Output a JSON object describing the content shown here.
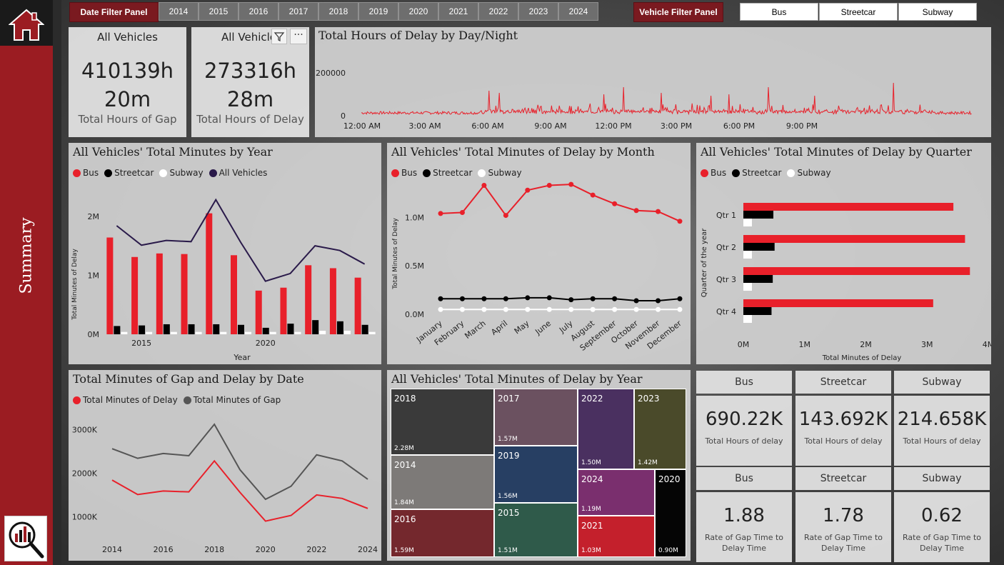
{
  "sidebar": {
    "label": "Summary"
  },
  "filters": {
    "date_panel_label": "Date Filter Panel",
    "years": [
      "2014",
      "2015",
      "2016",
      "2017",
      "2018",
      "2019",
      "2020",
      "2021",
      "2022",
      "2023",
      "2024"
    ],
    "vehicle_panel_label": "Vehicle Filter Panel",
    "vehicles": [
      "Bus",
      "Streetcar",
      "Subway"
    ]
  },
  "kpis": [
    {
      "title": "All Vehicles",
      "value_line1": "410139h",
      "value_line2": "20m",
      "subtitle": "Total Hours of Gap"
    },
    {
      "title": "All Vehicles",
      "value_line1": "273316h",
      "value_line2": "28m",
      "subtitle": "Total Hours of Delay"
    }
  ],
  "daynight": {
    "title": "Total Hours of Delay by Day/Night",
    "y_ticks": [
      "200000",
      "0"
    ],
    "x_ticks": [
      "12:00 AM",
      "3:00 AM",
      "6:00 AM",
      "9:00 AM",
      "12:00 PM",
      "3:00 PM",
      "6:00 PM",
      "9:00 PM"
    ]
  },
  "by_year": {
    "title": "All Vehicles' Total Minutes by Year",
    "legend": [
      "Bus",
      "Streetcar",
      "Subway",
      "All Vehicles"
    ],
    "y_ticks": [
      "2M",
      "1M",
      "0M"
    ],
    "y_label": "Total Minutes of Delay",
    "x_ticks": [
      "2015",
      "2020"
    ],
    "x_label": "Year"
  },
  "by_month": {
    "title": "All Vehicles' Total Minutes of Delay by Month",
    "legend": [
      "Bus",
      "Streetcar",
      "Subway"
    ],
    "y_ticks": [
      "1.0M",
      "0.5M",
      "0.0M"
    ],
    "y_label": "Total Minutes of Delay",
    "x_ticks": [
      "January",
      "February",
      "March",
      "April",
      "May",
      "June",
      "July",
      "August",
      "September",
      "October",
      "November",
      "December"
    ]
  },
  "by_quarter": {
    "title": "All Vehicles' Total Minutes of Delay by Quarter",
    "legend": [
      "Bus",
      "Streetcar",
      "Subway"
    ],
    "y_ticks": [
      "Qtr 1",
      "Qtr 2",
      "Qtr 3",
      "Qtr 4"
    ],
    "y_label": "Quarter of the year",
    "x_ticks": [
      "0M",
      "1M",
      "2M",
      "3M",
      "4M"
    ],
    "x_label": "Total Minutes of Delay"
  },
  "gap_delay": {
    "title": "Total Minutes of Gap and Delay by Date",
    "legend": [
      "Total Minutes of Delay",
      "Total Minutes of Gap"
    ],
    "y_ticks": [
      "3000K",
      "2000K",
      "1000K"
    ],
    "x_ticks": [
      "2014",
      "2016",
      "2018",
      "2020",
      "2022",
      "2024"
    ]
  },
  "treemap": {
    "title": "All Vehicles' Total Minutes of Delay by Year",
    "cells": [
      {
        "year": "2018",
        "value": "2.28M",
        "color": "#3a3a3a"
      },
      {
        "year": "2017",
        "value": "1.57M",
        "color": "#6b5160"
      },
      {
        "year": "2022",
        "value": "1.50M",
        "color": "#4a3060"
      },
      {
        "year": "2023",
        "value": "1.42M",
        "color": "#4a4a2a"
      },
      {
        "year": "2014",
        "value": "1.84M",
        "color": "#7d7a78"
      },
      {
        "year": "2019",
        "value": "1.56M",
        "color": "#273f63"
      },
      {
        "year": "2024",
        "value": "1.19M",
        "color": "#7a2f6e"
      },
      {
        "year": "2020",
        "value": "0.90M",
        "color": "#050505"
      },
      {
        "year": "2016",
        "value": "1.59M",
        "color": "#74282d"
      },
      {
        "year": "2015",
        "value": "1.51M",
        "color": "#2f5a4a"
      },
      {
        "year": "2021",
        "value": "1.03M",
        "color": "#c4202c"
      }
    ]
  },
  "vehicle_delay": [
    {
      "head": "Bus",
      "value": "690.22K",
      "sub": "Total Hours of delay"
    },
    {
      "head": "Streetcar",
      "value": "143.692K",
      "sub": "Total Hours of delay"
    },
    {
      "head": "Subway",
      "value": "214.658K",
      "sub": "Total Hours of delay"
    }
  ],
  "vehicle_rate": [
    {
      "head": "Bus",
      "value": "1.88",
      "sub": "Rate of Gap Time to Delay Time"
    },
    {
      "head": "Streetcar",
      "value": "1.78",
      "sub": "Rate of Gap Time to Delay Time"
    },
    {
      "head": "Subway",
      "value": "0.62",
      "sub": "Rate of Gap Time to Delay Time"
    }
  ],
  "colors": {
    "bus": "#e8202a",
    "streetcar": "#000000",
    "subway": "#ffffff",
    "all": "#2a1a4a",
    "gap": "#555555"
  },
  "chart_data": [
    {
      "type": "bar",
      "title": "All Vehicles' Total Minutes by Year",
      "categories": [
        "2014",
        "2015",
        "2016",
        "2017",
        "2018",
        "2019",
        "2020",
        "2021",
        "2022",
        "2023",
        "2024"
      ],
      "series": [
        {
          "name": "Bus",
          "values": [
            1640000,
            1310000,
            1370000,
            1360000,
            2050000,
            1340000,
            740000,
            790000,
            1170000,
            1120000,
            960000
          ]
        },
        {
          "name": "Streetcar",
          "values": [
            140000,
            150000,
            170000,
            170000,
            170000,
            160000,
            110000,
            180000,
            240000,
            220000,
            160000
          ]
        },
        {
          "name": "Subway",
          "values": [
            40000,
            40000,
            40000,
            40000,
            40000,
            40000,
            40000,
            40000,
            60000,
            60000,
            40000
          ]
        },
        {
          "name": "All Vehicles",
          "values": [
            1840000,
            1510000,
            1590000,
            1570000,
            2280000,
            1560000,
            900000,
            1030000,
            1500000,
            1420000,
            1190000
          ]
        }
      ],
      "ylabel": "Total Minutes of Delay",
      "xlabel": "Year",
      "ylim": [
        0,
        2300000
      ]
    },
    {
      "type": "line",
      "title": "All Vehicles' Total Minutes of Delay by Month",
      "categories": [
        "January",
        "February",
        "March",
        "April",
        "May",
        "June",
        "July",
        "August",
        "September",
        "October",
        "November",
        "December"
      ],
      "series": [
        {
          "name": "Bus",
          "values": [
            1040000,
            1050000,
            1330000,
            1020000,
            1280000,
            1330000,
            1340000,
            1230000,
            1140000,
            1070000,
            1060000,
            960000
          ]
        },
        {
          "name": "Streetcar",
          "values": [
            160000,
            160000,
            160000,
            160000,
            170000,
            170000,
            150000,
            160000,
            160000,
            140000,
            140000,
            160000
          ]
        },
        {
          "name": "Subway",
          "values": [
            50000,
            50000,
            50000,
            50000,
            50000,
            50000,
            50000,
            50000,
            50000,
            50000,
            50000,
            50000
          ]
        }
      ],
      "ylabel": "Total Minutes of Delay",
      "ylim": [
        0,
        1400000
      ]
    },
    {
      "type": "bar",
      "title": "All Vehicles' Total Minutes of Delay by Quarter",
      "categories": [
        "Qtr 1",
        "Qtr 2",
        "Qtr 3",
        "Qtr 4"
      ],
      "series": [
        {
          "name": "Bus",
          "values": [
            3430000,
            3620000,
            3700000,
            3100000
          ]
        },
        {
          "name": "Streetcar",
          "values": [
            490000,
            510000,
            480000,
            460000
          ]
        },
        {
          "name": "Subway",
          "values": [
            140000,
            140000,
            140000,
            140000
          ]
        }
      ],
      "xlabel": "Total Minutes of Delay",
      "ylabel": "Quarter of the year",
      "xlim": [
        0,
        4000000
      ]
    },
    {
      "type": "line",
      "title": "Total Minutes of Gap and Delay by Date",
      "categories": [
        "2014",
        "2015",
        "2016",
        "2017",
        "2018",
        "2019",
        "2020",
        "2021",
        "2022",
        "2023",
        "2024"
      ],
      "series": [
        {
          "name": "Total Minutes of Delay",
          "values": [
            1840000,
            1510000,
            1590000,
            1570000,
            2280000,
            1560000,
            900000,
            1030000,
            1500000,
            1420000,
            1190000
          ]
        },
        {
          "name": "Total Minutes of Gap",
          "values": [
            2560000,
            2340000,
            2450000,
            2400000,
            3120000,
            2080000,
            1400000,
            1700000,
            2420000,
            2280000,
            1860000
          ]
        }
      ],
      "ylim": [
        500000,
        3300000
      ]
    },
    {
      "type": "line",
      "title": "Total Hours of Delay by Day/Night",
      "categories": [
        "12:00 AM",
        "3:00 AM",
        "6:00 AM",
        "9:00 AM",
        "12:00 PM",
        "3:00 PM",
        "6:00 PM",
        "9:00 PM"
      ],
      "series": [
        {
          "name": "",
          "values": [
            5000,
            8000,
            50000,
            30000,
            25000,
            30000,
            20000,
            25000
          ]
        }
      ],
      "ylim": [
        0,
        260000
      ]
    }
  ]
}
